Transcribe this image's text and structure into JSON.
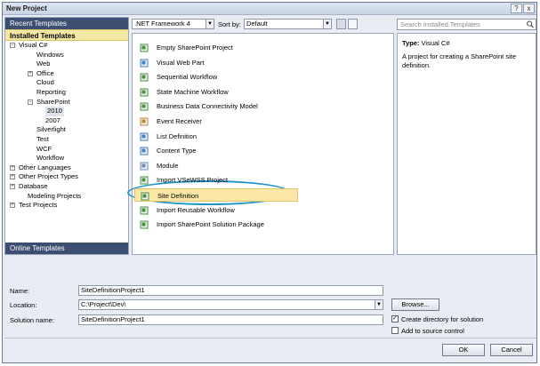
{
  "window": {
    "title": "New Project",
    "close": "x"
  },
  "left": {
    "recent": "Recent Templates",
    "installed": "Installed Templates",
    "online": "Online Templates",
    "tree": [
      {
        "label": "Visual C#",
        "indent": 0,
        "exp": "-"
      },
      {
        "label": "Windows",
        "indent": 2,
        "exp": ""
      },
      {
        "label": "Web",
        "indent": 2,
        "exp": ""
      },
      {
        "label": "Office",
        "indent": 2,
        "exp": "+"
      },
      {
        "label": "Cloud",
        "indent": 2,
        "exp": ""
      },
      {
        "label": "Reporting",
        "indent": 2,
        "exp": ""
      },
      {
        "label": "SharePoint",
        "indent": 2,
        "exp": "-"
      },
      {
        "label": "2010",
        "indent": 3,
        "exp": "",
        "selected": true
      },
      {
        "label": "2007",
        "indent": 3,
        "exp": ""
      },
      {
        "label": "Silverlight",
        "indent": 2,
        "exp": ""
      },
      {
        "label": "Test",
        "indent": 2,
        "exp": ""
      },
      {
        "label": "WCF",
        "indent": 2,
        "exp": ""
      },
      {
        "label": "Workflow",
        "indent": 2,
        "exp": ""
      },
      {
        "label": "Other Languages",
        "indent": 0,
        "exp": "+"
      },
      {
        "label": "Other Project Types",
        "indent": 0,
        "exp": "+"
      },
      {
        "label": "Database",
        "indent": 0,
        "exp": "+"
      },
      {
        "label": "Modeling Projects",
        "indent": 1,
        "exp": ""
      },
      {
        "label": "Test Projects",
        "indent": 0,
        "exp": "+"
      }
    ]
  },
  "toolbar": {
    "framework": ".NET Framework 4",
    "sortby_label": "Sort by:",
    "sortby": "Default",
    "search_placeholder": "Search Installed Templates"
  },
  "templates": [
    {
      "label": "Empty SharePoint Project",
      "icon": "sharepoint-project-icon",
      "color": "#4a8f3a"
    },
    {
      "label": "Visual Web Part",
      "icon": "web-part-icon",
      "color": "#3f7fbf"
    },
    {
      "label": "Sequential Workflow",
      "icon": "workflow-icon",
      "color": "#4a8f3a"
    },
    {
      "label": "State Machine Workflow",
      "icon": "workflow-icon",
      "color": "#4a8f3a"
    },
    {
      "label": "Business Data Connectivity Model",
      "icon": "bdc-model-icon",
      "color": "#4a8f3a"
    },
    {
      "label": "Event Receiver",
      "icon": "event-receiver-icon",
      "color": "#c0862e"
    },
    {
      "label": "List Definition",
      "icon": "list-icon",
      "color": "#3f7fbf"
    },
    {
      "label": "Content Type",
      "icon": "content-type-icon",
      "color": "#3f7fbf"
    },
    {
      "label": "Module",
      "icon": "module-icon",
      "color": "#6b8bb0"
    },
    {
      "label": "Import VSeWSS Project",
      "icon": "import-icon",
      "color": "#4a8f3a"
    },
    {
      "label": "Site Definition",
      "icon": "site-definition-icon",
      "color": "#4a8f3a",
      "selected": true
    },
    {
      "label": "Import Reusable Workflow",
      "icon": "import-workflow-icon",
      "color": "#4a8f3a"
    },
    {
      "label": "Import SharePoint Solution Package",
      "icon": "import-package-icon",
      "color": "#4a8f3a"
    }
  ],
  "details": {
    "type_label": "Type:",
    "type_value": "Visual C#",
    "description": "A project for creating a SharePoint site definition."
  },
  "form": {
    "name_label": "Name:",
    "name_value": "SiteDefinitionProject1",
    "location_label": "Location:",
    "location_value": "C:\\Project\\Dev\\",
    "solution_label": "Solution name:",
    "solution_value": "SiteDefinitionProject1",
    "browse": "Browse...",
    "create_dir": "Create directory for solution",
    "create_dir_checked": true,
    "source_control": "Add to source control",
    "source_control_checked": false,
    "ok": "OK",
    "cancel": "Cancel"
  }
}
